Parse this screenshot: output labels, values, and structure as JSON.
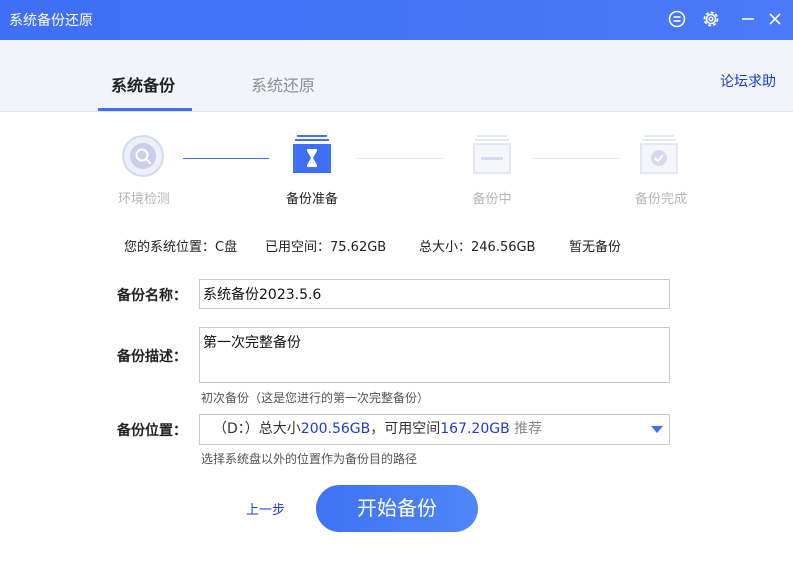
{
  "window": {
    "title": "系统备份还原"
  },
  "tabs": [
    {
      "label": "系统备份",
      "active": true
    },
    {
      "label": "系统还原",
      "active": false
    }
  ],
  "help_link": "论坛求助",
  "steps": [
    {
      "label": "环境检测",
      "state": "done"
    },
    {
      "label": "备份准备",
      "state": "current"
    },
    {
      "label": "备份中",
      "state": "pending"
    },
    {
      "label": "备份完成",
      "state": "pending"
    }
  ],
  "info": {
    "system_location": "您的系统位置：C盘",
    "used_space": "已用空间：75.62GB",
    "total_size": "总大小：246.56GB",
    "backup_status": "暂无备份"
  },
  "form": {
    "name_label": "备份名称：",
    "name_value": "系统备份2023.5.6",
    "desc_label": "备份描述：",
    "desc_value": "第一次完整备份",
    "desc_hint": "初次备份（这是您进行的第一次完整备份）",
    "location_label": "备份位置：",
    "location": {
      "prefix": "（D：）总大小",
      "total": "200.56GB",
      "mid": "，可用空间",
      "free": "167.20GB",
      "tag": " 推荐"
    },
    "location_hint": "选择系统盘以外的位置作为备份目的路径"
  },
  "buttons": {
    "prev": "上一步",
    "start": "开始备份"
  },
  "colors": {
    "accent": "#3f6ff5",
    "link": "#1d3bd6"
  }
}
